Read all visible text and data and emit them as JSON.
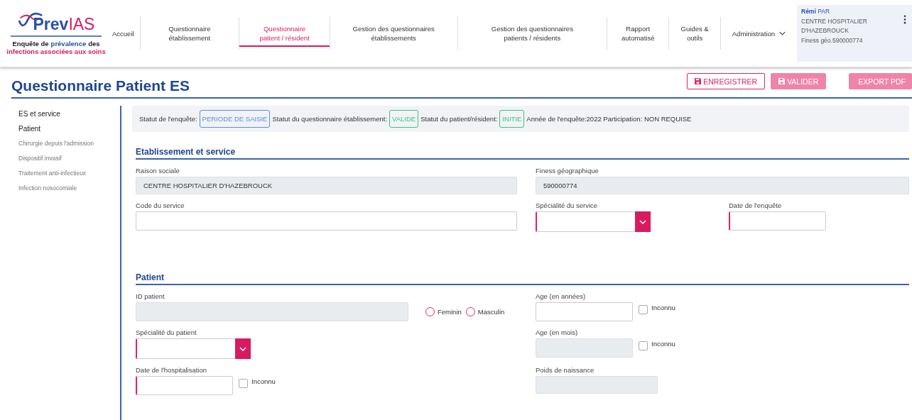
{
  "header": {
    "logo": {
      "part_1": "Prev",
      "part_2": "IAS"
    },
    "tagline": [
      {
        "text": "Enquête de",
        "color": "#222222"
      },
      {
        "text": "prévalence",
        "color": "#2b4fa8"
      },
      {
        "text": "des",
        "color": "#222222"
      },
      {
        "text": "infections associées aux soins",
        "color": "#d81b60"
      }
    ],
    "nav": [
      {
        "label": "Accueil",
        "selected": false,
        "kind": "link"
      },
      {
        "label": "Questionnaire établissement",
        "selected": false,
        "kind": "link"
      },
      {
        "label": "Questionnaire patient / résident",
        "selected": true,
        "kind": "link"
      },
      {
        "label": "Gestion des questionnaires établissements",
        "selected": false,
        "kind": "link"
      },
      {
        "label": "Gestion des questionnaires patients / résidents",
        "selected": false,
        "kind": "link"
      },
      {
        "label": "Rapport automatisé",
        "selected": false,
        "kind": "link"
      },
      {
        "label": "Guides & outils",
        "selected": false,
        "kind": "link"
      },
      {
        "label": "Administration",
        "selected": false,
        "kind": "dropdown"
      }
    ],
    "user": {
      "first_name": "Rémi",
      "last_name": "PAR",
      "organisation": "CENTRE HOSPITALIER D'HAZEBROUCK",
      "finess": "Finess géo.590000774"
    }
  },
  "page": {
    "title": "Questionnaire Patient ES",
    "buttons": [
      {
        "label": "ENREGISTRER",
        "kind": "outline"
      },
      {
        "label": "VALIDER",
        "kind": "filled-icon"
      },
      {
        "label": "EXPORT PDF",
        "kind": "filled"
      }
    ]
  },
  "sidebar": {
    "items": [
      {
        "label": "ES et service",
        "disabled": false
      },
      {
        "label": "Patient",
        "disabled": false
      },
      {
        "label": "Chirurgie depuis l'admission",
        "disabled": true
      },
      {
        "label": "Dispositif invasif",
        "disabled": true
      },
      {
        "label": "Traitement anti-infectieux",
        "disabled": true
      },
      {
        "label": "Infection nosocomiale",
        "disabled": true
      }
    ]
  },
  "status_bar": [
    {
      "kind": "text",
      "text": "Statut de l'enquête:"
    },
    {
      "kind": "badge",
      "text": "PERIODE DE SAISIE",
      "color": "#5b8fd9"
    },
    {
      "kind": "text",
      "text": "Statut du questionnaire établissement:"
    },
    {
      "kind": "badge",
      "text": "VALIDE",
      "color": "#3cc47c"
    },
    {
      "kind": "text",
      "text": "Statut du patient/résident:"
    },
    {
      "kind": "badge",
      "text": "INITIE",
      "color": "#3cc47c"
    },
    {
      "kind": "text",
      "text": "Année de l'enquête:2022 Participation:  NON REQUISE"
    }
  ],
  "establishment": {
    "title": "Etablissement et service",
    "raison_sociale": {
      "label": "Raison sociale",
      "value": "CENTRE HOSPITALIER D'HAZEBROUCK",
      "disabled": true,
      "required": false
    },
    "finess": {
      "label": "Finess géographique",
      "value": "590000774",
      "disabled": true,
      "required": false
    },
    "code_service": {
      "label": "Code du service",
      "disabled": false,
      "required": false
    },
    "specialite_service": {
      "label": "Spécialité du service",
      "required": true
    },
    "date_enquete": {
      "label": "Date de l'enquête",
      "disabled": false,
      "required": true
    }
  },
  "patient": {
    "title": "Patient",
    "id_patient": {
      "label": "ID patient",
      "disabled": true,
      "required": false
    },
    "sex": [
      {
        "label": "Feminin",
        "selected": false
      },
      {
        "label": "Masculin",
        "selected": false
      }
    ],
    "age_years": {
      "label": "Age (en années)",
      "disabled": false,
      "required": false,
      "unknown": {
        "label": "Inconnu",
        "checked": false
      }
    },
    "specialite_patient": {
      "label": "Spécialité du patient",
      "required": true
    },
    "age_months": {
      "label": "Age (en mois)",
      "disabled": true,
      "required": false,
      "unknown": {
        "label": "Inconnu",
        "checked": false
      }
    },
    "date_hospitalisation": {
      "label": "Date de l'hospitalisation",
      "disabled": false,
      "required": true,
      "unknown": {
        "label": "Inconnu",
        "checked": false
      }
    },
    "poids": {
      "label": "Poids de naissance",
      "disabled": true,
      "required": false
    }
  }
}
